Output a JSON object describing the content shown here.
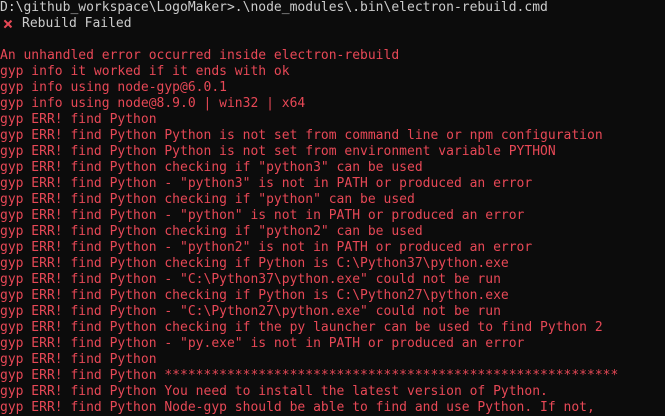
{
  "prompt": "D:\\github_workspace\\LogoMaker>.\\node_modules\\.bin\\electron-rebuild.cmd",
  "status": {
    "icon": "cross-icon",
    "text": "Rebuild Failed"
  },
  "log_lines": [
    "An unhandled error occurred inside electron-rebuild",
    "gyp info it worked if it ends with ok",
    "gyp info using node-gyp@6.0.1",
    "gyp info using node@8.9.0 | win32 | x64",
    "gyp ERR! find Python",
    "gyp ERR! find Python Python is not set from command line or npm configuration",
    "gyp ERR! find Python Python is not set from environment variable PYTHON",
    "gyp ERR! find Python checking if \"python3\" can be used",
    "gyp ERR! find Python - \"python3\" is not in PATH or produced an error",
    "gyp ERR! find Python checking if \"python\" can be used",
    "gyp ERR! find Python - \"python\" is not in PATH or produced an error",
    "gyp ERR! find Python checking if \"python2\" can be used",
    "gyp ERR! find Python - \"python2\" is not in PATH or produced an error",
    "gyp ERR! find Python checking if Python is C:\\Python37\\python.exe",
    "gyp ERR! find Python - \"C:\\Python37\\python.exe\" could not be run",
    "gyp ERR! find Python checking if Python is C:\\Python27\\python.exe",
    "gyp ERR! find Python - \"C:\\Python27\\python.exe\" could not be run",
    "gyp ERR! find Python checking if the py launcher can be used to find Python 2",
    "gyp ERR! find Python - \"py.exe\" is not in PATH or produced an error",
    "gyp ERR! find Python",
    "gyp ERR! find Python **********************************************************",
    "gyp ERR! find Python You need to install the latest version of Python.",
    "gyp ERR! find Python Node-gyp should be able to find and use Python. If not,"
  ],
  "colors": {
    "background": "#0c0c0c",
    "text": "#cccccc",
    "error": "#e74856"
  }
}
